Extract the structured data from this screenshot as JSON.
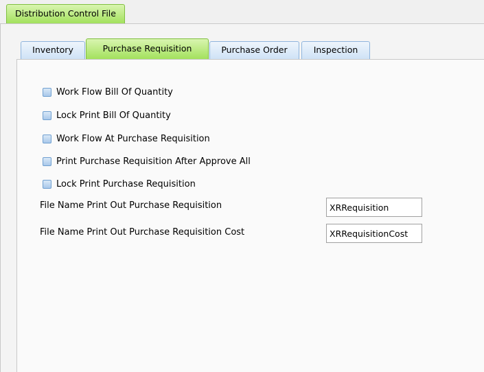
{
  "outer_tab": {
    "label": "Distribution Control File"
  },
  "inner_tabs": [
    {
      "label": "Inventory",
      "active": false
    },
    {
      "label": "Purchase Requisition",
      "active": true
    },
    {
      "label": "Purchase Order",
      "active": false
    },
    {
      "label": "Inspection",
      "active": false
    }
  ],
  "checkboxes": [
    {
      "label": "Work Flow Bill Of Quantity",
      "checked": false
    },
    {
      "label": "Lock Print Bill Of Quantity",
      "checked": false
    },
    {
      "label": "Work Flow At Purchase Requisition",
      "checked": false
    },
    {
      "label": "Print Purchase Requisition After Approve All",
      "checked": false
    },
    {
      "label": "Lock Print Purchase Requisition",
      "checked": false
    }
  ],
  "fields": [
    {
      "label": "File Name Print Out Purchase Requisition",
      "value": "XRRequisition"
    },
    {
      "label": "File Name Print Out Purchase Requisition Cost",
      "value": "XRRequisitionCost"
    }
  ]
}
